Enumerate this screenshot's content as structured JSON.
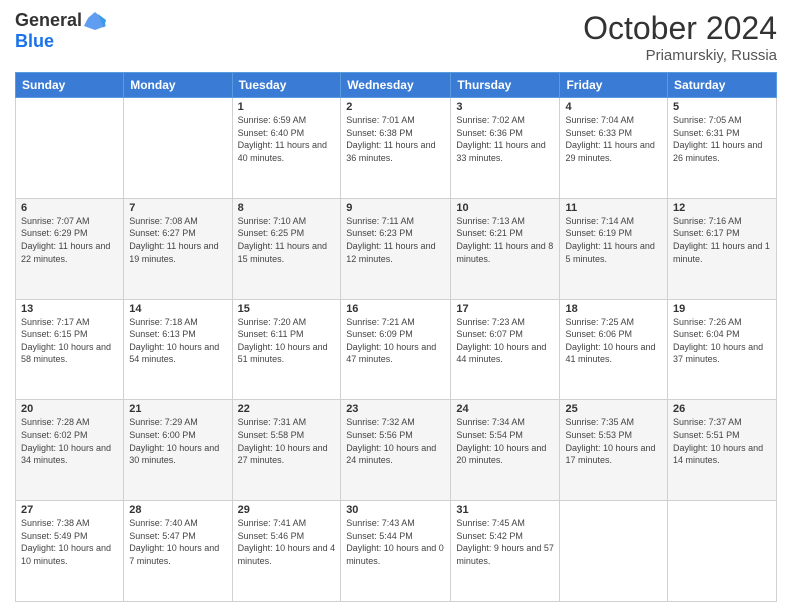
{
  "header": {
    "logo_general": "General",
    "logo_blue": "Blue",
    "title": "October 2024",
    "location": "Priamurskiy, Russia"
  },
  "days_of_week": [
    "Sunday",
    "Monday",
    "Tuesday",
    "Wednesday",
    "Thursday",
    "Friday",
    "Saturday"
  ],
  "weeks": [
    [
      {
        "day": "",
        "info": ""
      },
      {
        "day": "",
        "info": ""
      },
      {
        "day": "1",
        "info": "Sunrise: 6:59 AM\nSunset: 6:40 PM\nDaylight: 11 hours and 40 minutes."
      },
      {
        "day": "2",
        "info": "Sunrise: 7:01 AM\nSunset: 6:38 PM\nDaylight: 11 hours and 36 minutes."
      },
      {
        "day": "3",
        "info": "Sunrise: 7:02 AM\nSunset: 6:36 PM\nDaylight: 11 hours and 33 minutes."
      },
      {
        "day": "4",
        "info": "Sunrise: 7:04 AM\nSunset: 6:33 PM\nDaylight: 11 hours and 29 minutes."
      },
      {
        "day": "5",
        "info": "Sunrise: 7:05 AM\nSunset: 6:31 PM\nDaylight: 11 hours and 26 minutes."
      }
    ],
    [
      {
        "day": "6",
        "info": "Sunrise: 7:07 AM\nSunset: 6:29 PM\nDaylight: 11 hours and 22 minutes."
      },
      {
        "day": "7",
        "info": "Sunrise: 7:08 AM\nSunset: 6:27 PM\nDaylight: 11 hours and 19 minutes."
      },
      {
        "day": "8",
        "info": "Sunrise: 7:10 AM\nSunset: 6:25 PM\nDaylight: 11 hours and 15 minutes."
      },
      {
        "day": "9",
        "info": "Sunrise: 7:11 AM\nSunset: 6:23 PM\nDaylight: 11 hours and 12 minutes."
      },
      {
        "day": "10",
        "info": "Sunrise: 7:13 AM\nSunset: 6:21 PM\nDaylight: 11 hours and 8 minutes."
      },
      {
        "day": "11",
        "info": "Sunrise: 7:14 AM\nSunset: 6:19 PM\nDaylight: 11 hours and 5 minutes."
      },
      {
        "day": "12",
        "info": "Sunrise: 7:16 AM\nSunset: 6:17 PM\nDaylight: 11 hours and 1 minute."
      }
    ],
    [
      {
        "day": "13",
        "info": "Sunrise: 7:17 AM\nSunset: 6:15 PM\nDaylight: 10 hours and 58 minutes."
      },
      {
        "day": "14",
        "info": "Sunrise: 7:18 AM\nSunset: 6:13 PM\nDaylight: 10 hours and 54 minutes."
      },
      {
        "day": "15",
        "info": "Sunrise: 7:20 AM\nSunset: 6:11 PM\nDaylight: 10 hours and 51 minutes."
      },
      {
        "day": "16",
        "info": "Sunrise: 7:21 AM\nSunset: 6:09 PM\nDaylight: 10 hours and 47 minutes."
      },
      {
        "day": "17",
        "info": "Sunrise: 7:23 AM\nSunset: 6:07 PM\nDaylight: 10 hours and 44 minutes."
      },
      {
        "day": "18",
        "info": "Sunrise: 7:25 AM\nSunset: 6:06 PM\nDaylight: 10 hours and 41 minutes."
      },
      {
        "day": "19",
        "info": "Sunrise: 7:26 AM\nSunset: 6:04 PM\nDaylight: 10 hours and 37 minutes."
      }
    ],
    [
      {
        "day": "20",
        "info": "Sunrise: 7:28 AM\nSunset: 6:02 PM\nDaylight: 10 hours and 34 minutes."
      },
      {
        "day": "21",
        "info": "Sunrise: 7:29 AM\nSunset: 6:00 PM\nDaylight: 10 hours and 30 minutes."
      },
      {
        "day": "22",
        "info": "Sunrise: 7:31 AM\nSunset: 5:58 PM\nDaylight: 10 hours and 27 minutes."
      },
      {
        "day": "23",
        "info": "Sunrise: 7:32 AM\nSunset: 5:56 PM\nDaylight: 10 hours and 24 minutes."
      },
      {
        "day": "24",
        "info": "Sunrise: 7:34 AM\nSunset: 5:54 PM\nDaylight: 10 hours and 20 minutes."
      },
      {
        "day": "25",
        "info": "Sunrise: 7:35 AM\nSunset: 5:53 PM\nDaylight: 10 hours and 17 minutes."
      },
      {
        "day": "26",
        "info": "Sunrise: 7:37 AM\nSunset: 5:51 PM\nDaylight: 10 hours and 14 minutes."
      }
    ],
    [
      {
        "day": "27",
        "info": "Sunrise: 7:38 AM\nSunset: 5:49 PM\nDaylight: 10 hours and 10 minutes."
      },
      {
        "day": "28",
        "info": "Sunrise: 7:40 AM\nSunset: 5:47 PM\nDaylight: 10 hours and 7 minutes."
      },
      {
        "day": "29",
        "info": "Sunrise: 7:41 AM\nSunset: 5:46 PM\nDaylight: 10 hours and 4 minutes."
      },
      {
        "day": "30",
        "info": "Sunrise: 7:43 AM\nSunset: 5:44 PM\nDaylight: 10 hours and 0 minutes."
      },
      {
        "day": "31",
        "info": "Sunrise: 7:45 AM\nSunset: 5:42 PM\nDaylight: 9 hours and 57 minutes."
      },
      {
        "day": "",
        "info": ""
      },
      {
        "day": "",
        "info": ""
      }
    ]
  ]
}
